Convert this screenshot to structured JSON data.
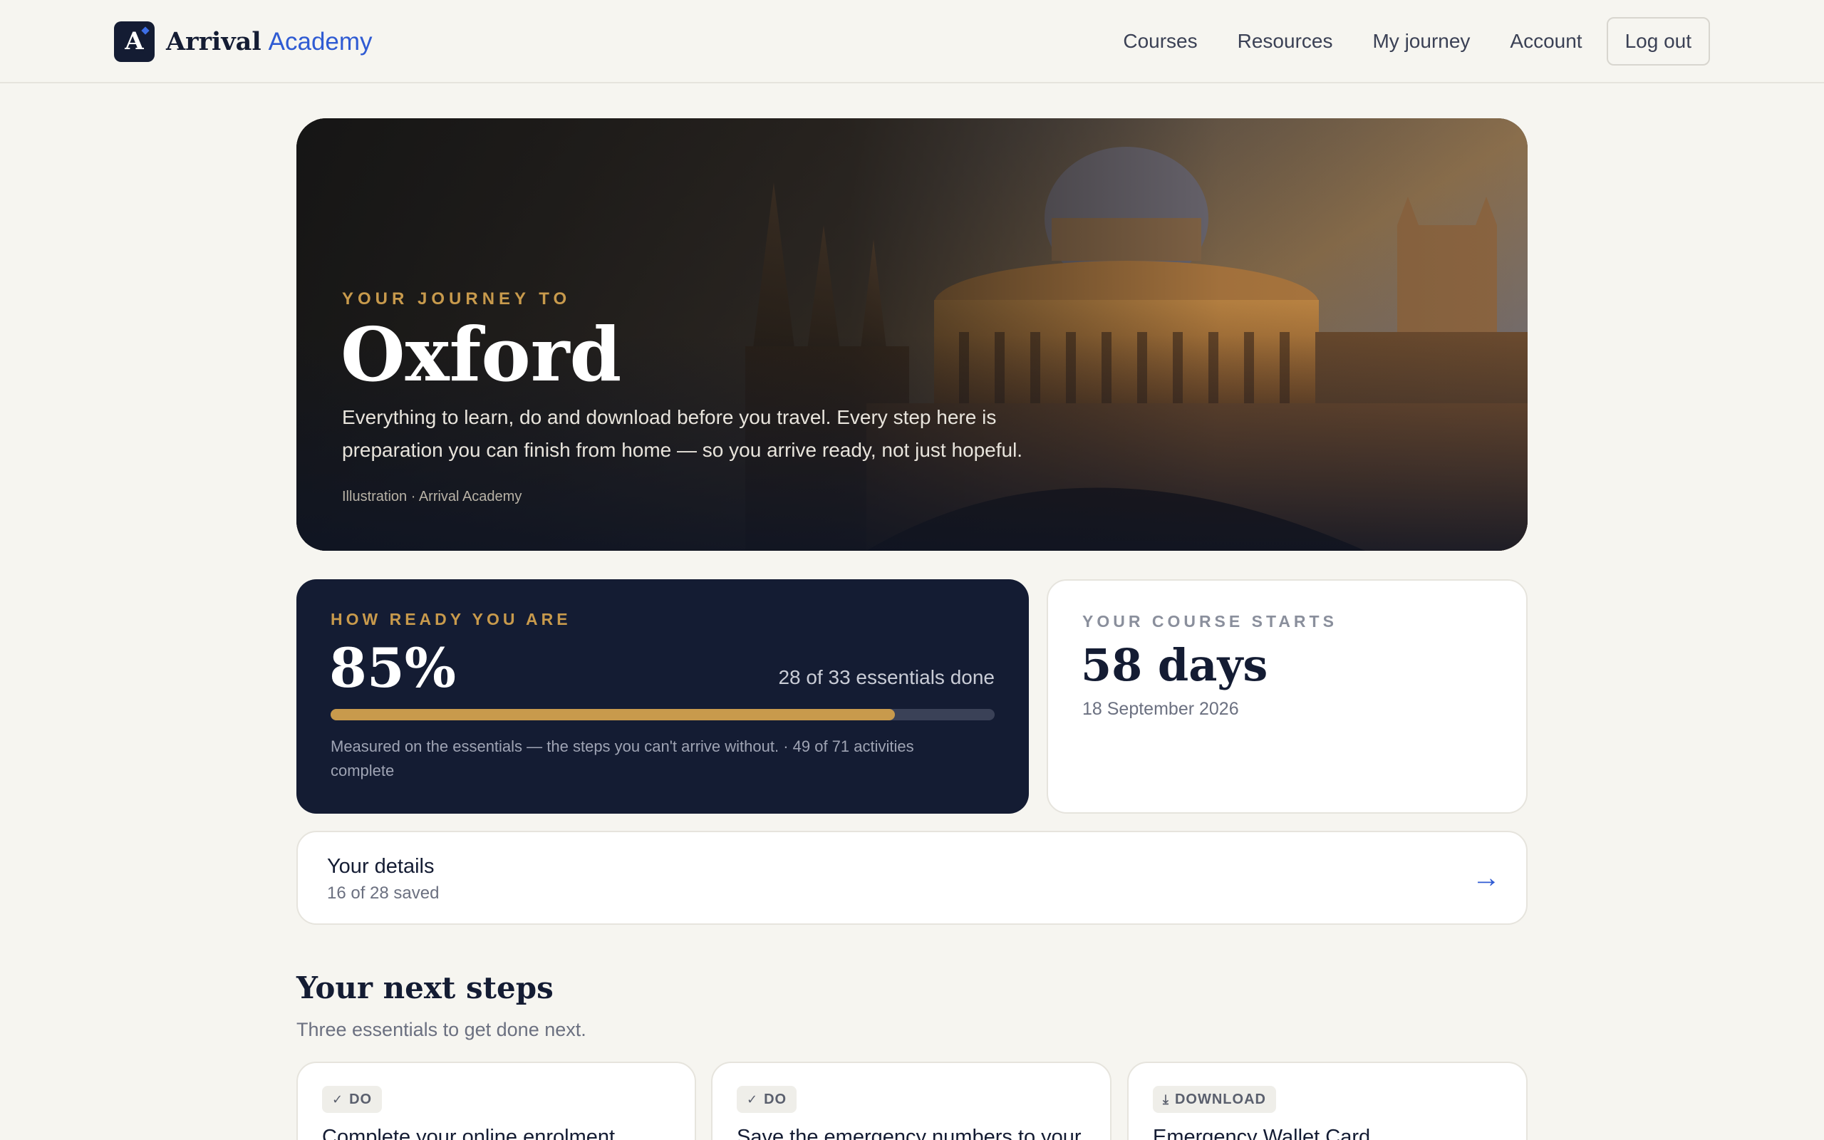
{
  "brand": {
    "logo_letter": "A",
    "name_bold": "Arrival",
    "name_accent": "Academy"
  },
  "nav": {
    "links": [
      "Courses",
      "Resources",
      "My journey",
      "Account"
    ],
    "logout": "Log out"
  },
  "hero": {
    "eyebrow": "YOUR JOURNEY TO",
    "title": "Oxford",
    "description": "Everything to learn, do and download before you travel. Every step here is preparation you can finish from home — so you arrive ready, not just hopeful.",
    "credit": "Illustration · Arrival Academy"
  },
  "readiness": {
    "eyebrow": "HOW READY YOU ARE",
    "percent_label": "85%",
    "progress": 0.85,
    "count_label": "28 of 33 essentials done",
    "note": "Measured on the essentials — the steps you can't arrive without. · 49 of 71 activities complete"
  },
  "course_start": {
    "eyebrow": "YOUR COURSE STARTS",
    "days": "58 days",
    "date": "18 September 2026"
  },
  "details": {
    "title": "Your details",
    "subtitle": "16 of 28 saved",
    "arrow": "→"
  },
  "next_steps": {
    "title": "Your next steps",
    "subtitle": "Three essentials to get done next.",
    "cards": [
      {
        "badge": "DO",
        "icon": "check-icon",
        "title": "Complete your online enrolment"
      },
      {
        "badge": "DO",
        "icon": "check-icon",
        "title": "Save the emergency numbers to your"
      },
      {
        "badge": "DOWNLOAD",
        "icon": "download-icon",
        "title": "Emergency Wallet Card"
      }
    ]
  },
  "colors": {
    "navy": "#141c33",
    "gold": "#c89a4c",
    "accent_blue": "#2f5bd3",
    "background": "#f6f5f0"
  }
}
